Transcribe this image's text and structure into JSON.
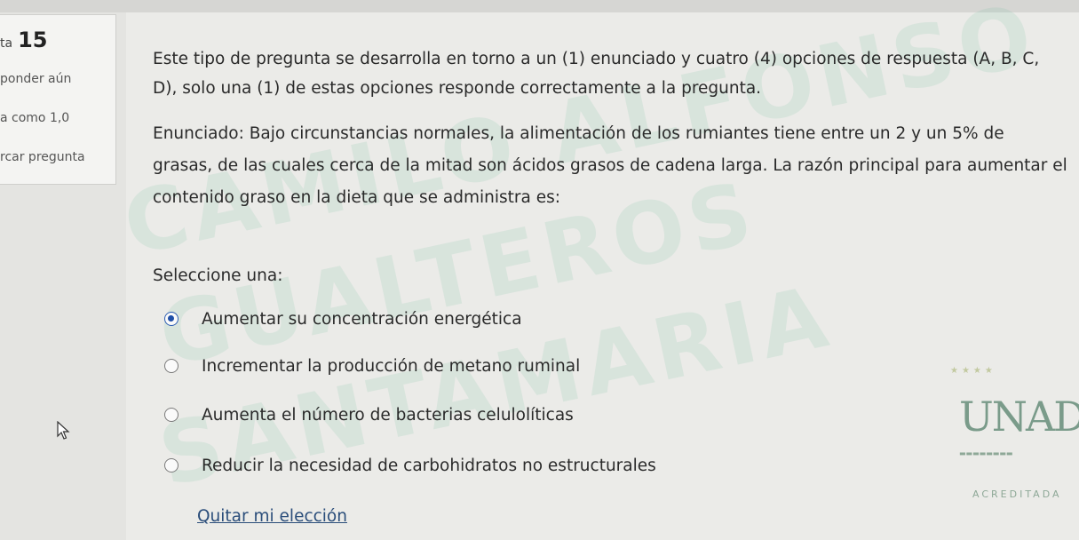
{
  "info": {
    "question_prefix": "ta",
    "question_number": "15",
    "status": "ponder aún",
    "grade": "a como 1,0",
    "flag": "rcar pregunta"
  },
  "question": {
    "instructions": "Este tipo de pregunta se desarrolla en torno a un (1) enunciado y cuatro (4) opciones de respuesta (A, B, C, D), solo una (1) de estas opciones responde correctamente a la pregunta.",
    "stem": "Enunciado: Bajo circunstancias normales, la alimentación de los rumiantes tiene entre un 2 y un 5% de grasas, de las cuales cerca de la mitad son ácidos grasos de cadena larga. La razón principal para aumentar el contenido graso en la dieta que se administra es:",
    "prompt": "Seleccione una:",
    "options": [
      {
        "label": "Aumentar su concentración energética",
        "selected": true
      },
      {
        "label": "Incrementar la producción de metano ruminal",
        "selected": false
      },
      {
        "label": "Aumenta el número de bacterias celulolíticas",
        "selected": false
      },
      {
        "label": "Reducir la necesidad de carbohidratos no estructurales",
        "selected": false
      }
    ],
    "clear_choice": "Quitar mi elección"
  },
  "watermark": {
    "line1": "CAMILO ALFONSO",
    "line2": "GUALTEROS",
    "line3": "SANTAMARIA"
  },
  "logo": {
    "letters": "UNAD",
    "acreditada": "ACREDITADA"
  },
  "colors": {
    "accent": "#1f4fa8",
    "link": "#2a4d7a",
    "watermark": "#78bea0"
  }
}
